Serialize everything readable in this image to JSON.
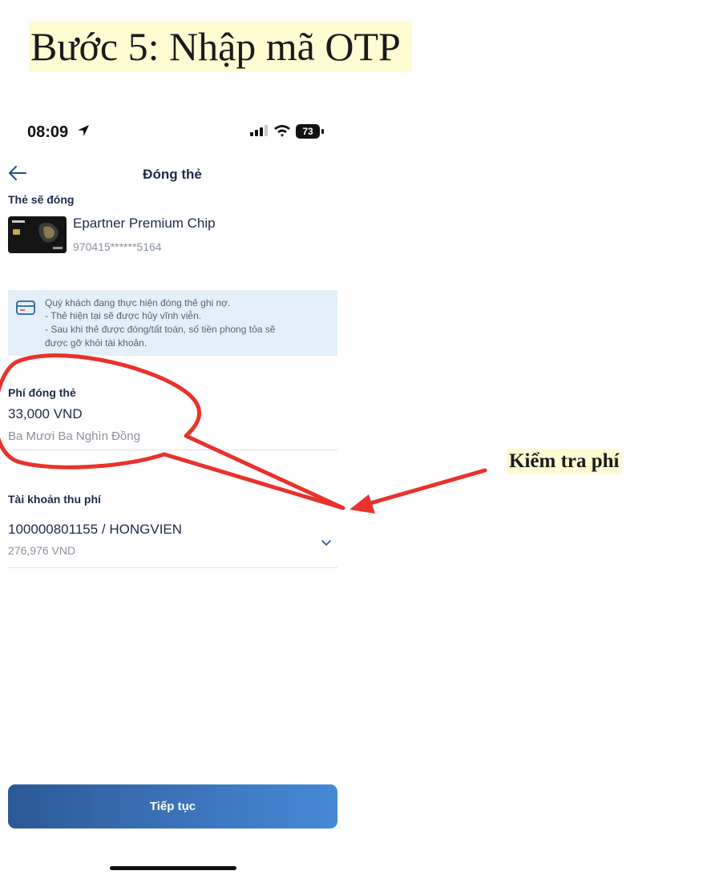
{
  "step_title": "Bước 5: Nhập mã OTP",
  "status_bar": {
    "time": "08:09",
    "battery": "73"
  },
  "header": {
    "title": "Đóng thẻ"
  },
  "card_section": {
    "label": "Thẻ sẽ đóng",
    "card_name": "Epartner Premium Chip",
    "card_number": "970415******5164"
  },
  "notice": {
    "lines": [
      "Quý khách đang thực hiện đóng thẻ ghi nợ.",
      "- Thẻ hiện tại sẽ được hủy vĩnh viễn.",
      "- Sau khi thẻ được đóng/tất toán, số tiền phong tỏa sẽ",
      "được gỡ khỏi tài khoản."
    ]
  },
  "fee": {
    "label": "Phí đóng thẻ",
    "value": "33,000 VND",
    "in_words": "Ba Mươi Ba Nghìn Đồng"
  },
  "fee_account": {
    "label": "Tài khoản thu phí",
    "account": "100000801155 / HONGVIEN",
    "balance": "276,976 VND"
  },
  "continue_button": {
    "label": "Tiếp tục"
  },
  "annotation": {
    "label": "Kiểm tra phí",
    "color": "#e8322b"
  },
  "colors": {
    "primary_text": "#1c2b4a",
    "notice_bg": "#e3f0f9",
    "button_start": "#2c5995",
    "button_end": "#4588d6"
  }
}
